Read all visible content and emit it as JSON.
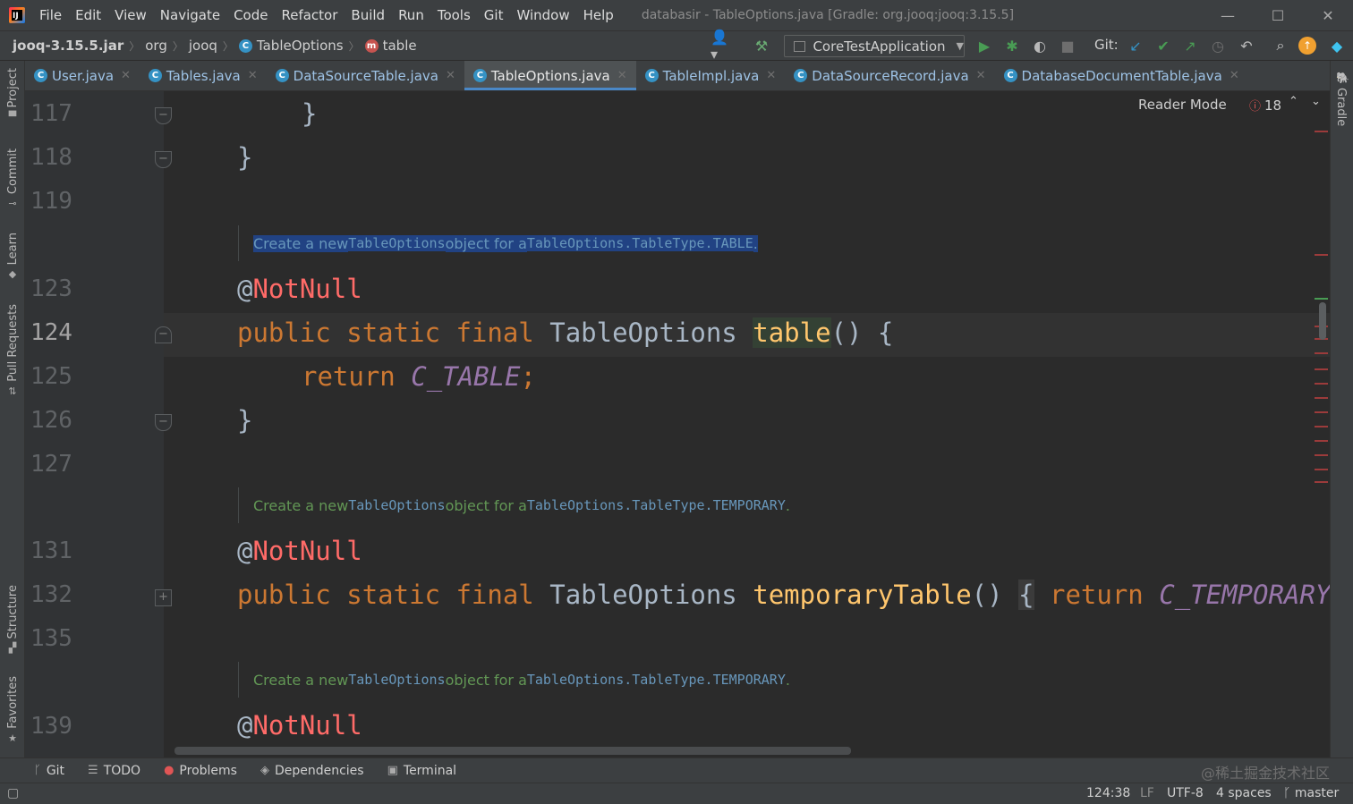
{
  "menu": {
    "items": [
      "File",
      "Edit",
      "View",
      "Navigate",
      "Code",
      "Refactor",
      "Build",
      "Run",
      "Tools",
      "Git",
      "Window",
      "Help"
    ],
    "window_title": "databasir - TableOptions.java [Gradle: org.jooq:jooq:3.15.5]",
    "logo_text": "IJ"
  },
  "window_controls": {
    "minimize": "—",
    "maximize": "☐",
    "close": "✕"
  },
  "breadcrumb": {
    "jar": "jooq-3.15.5.jar",
    "pkg1": "org",
    "pkg2": "jooq",
    "class": "TableOptions",
    "method": "table"
  },
  "toolbar": {
    "run_config": "CoreTestApplication",
    "git_label": "Git:"
  },
  "tabs": [
    {
      "label": "User.java"
    },
    {
      "label": "Tables.java"
    },
    {
      "label": "DataSourceTable.java"
    },
    {
      "label": "TableOptions.java",
      "active": true
    },
    {
      "label": "TableImpl.java"
    },
    {
      "label": "DataSourceRecord.java"
    },
    {
      "label": "DatabaseDocumentTable.java"
    }
  ],
  "tool_windows_left": [
    "Project",
    "Commit",
    "Learn",
    "Pull Requests",
    "Structure",
    "Favorites"
  ],
  "tool_windows_right": [
    "Gradle"
  ],
  "editor": {
    "reader_mode": "Reader Mode",
    "problems_count": "18",
    "line_numbers": {
      "l117": "117",
      "l118": "118",
      "l119": "119",
      "l123": "123",
      "l124": "124",
      "l125": "125",
      "l126": "126",
      "l127": "127",
      "l131": "131",
      "l132": "132",
      "l135": "135",
      "l139": "139"
    },
    "code": {
      "brace_117": "}",
      "brace_118": "}",
      "doc1": {
        "a": "Create a new ",
        "b": "TableOptions",
        "c": " object for a ",
        "d": "TableOptions.TableType.TABLE",
        "e": "."
      },
      "ann_at": "@",
      "ann_name": "NotNull",
      "kw_public": "public",
      "kw_static": "static",
      "kw_final": "final",
      "type": "TableOptions",
      "method_table": "table",
      "parens_open": "() {",
      "kw_return": "return",
      "const_table": "C_TABLE",
      "semicolon": ";",
      "brace_126": "}",
      "doc2": {
        "a": "Create a new ",
        "b": "TableOptions",
        "c": " object for a ",
        "d": "TableOptions.TableType.TEMPORARY",
        "e": "."
      },
      "method_temp": "temporaryTable",
      "parens": "()",
      "open_brace": "{",
      "const_temp": "C_TEMPORARY",
      "doc3": {
        "a": "Create a new ",
        "b": "TableOptions",
        "c": " object for a ",
        "d": "TableOptions.TableType.TEMPORARY",
        "e": "."
      }
    }
  },
  "bottom_tools": [
    {
      "label": "Git",
      "icon": "git-branch-icon"
    },
    {
      "label": "TODO",
      "icon": "list-icon"
    },
    {
      "label": "Problems",
      "icon": "error-icon"
    },
    {
      "label": "Dependencies",
      "icon": "layers-icon"
    },
    {
      "label": "Terminal",
      "icon": "terminal-icon"
    }
  ],
  "watermark": "@稀土掘金技术社区",
  "status": {
    "position": "124:38",
    "line_sep": "LF",
    "encoding": "UTF-8",
    "indent": "4 spaces",
    "branch": "master"
  },
  "colors": {
    "editor_bg": "#2b2b2b",
    "keyword": "#cc7832",
    "annotation": "#bbb529",
    "method": "#ffc66d",
    "constant": "#9876aa",
    "doc_comment": "#629755",
    "accent": "#4a88c7"
  }
}
